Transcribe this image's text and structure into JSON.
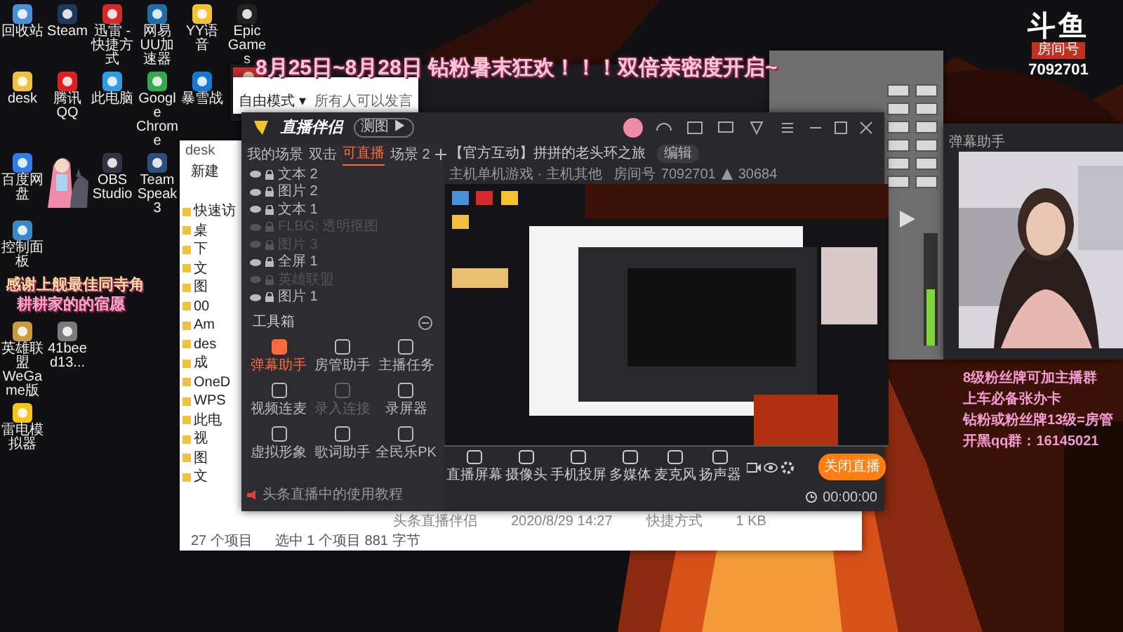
{
  "desktop": {
    "icon_rows": [
      {
        "icons": [
          {
            "kind": "app",
            "label": "回收站",
            "color": "#4a90d9"
          },
          {
            "kind": "app",
            "label": "Steam",
            "color": "#1b3a5c"
          },
          {
            "kind": "app",
            "label": "迅雷 - 快捷方式",
            "color": "#d42a2a"
          },
          {
            "kind": "app",
            "label": "网易UU加速器",
            "color": "#1e6fa8"
          },
          {
            "kind": "app",
            "label": "YY语音",
            "color": "#f2c230"
          },
          {
            "kind": "app",
            "label": "Epic Games",
            "color": "#222222"
          }
        ]
      },
      {
        "icons": [
          {
            "kind": "app",
            "label": "desk",
            "color": "#f0c040"
          },
          {
            "kind": "app",
            "label": "腾讯QQ",
            "color": "#e02020"
          },
          {
            "kind": "app",
            "label": "此电脑",
            "color": "#2f9be0"
          },
          {
            "kind": "app",
            "label": "Google Chrome",
            "color": "#34a853"
          },
          {
            "kind": "app",
            "label": "暴雪战",
            "color": "#1479d4"
          }
        ]
      },
      {
        "icons": [
          {
            "kind": "app",
            "label": "百度网盘",
            "color": "#2f7be8"
          },
          {
            "kind": "picture"
          },
          {
            "kind": "app",
            "label": "OBS Studio",
            "color": "#333344"
          },
          {
            "kind": "app",
            "label": "TeamSpeak 3",
            "color": "#2b4f80"
          }
        ]
      },
      {
        "icons": [
          {
            "kind": "app",
            "label": "控制面板",
            "color": "#3a88c8"
          }
        ]
      },
      {
        "icons": [
          {
            "kind": "app",
            "label": "英雄联盟WeGame版",
            "color": "#c89b3c"
          },
          {
            "kind": "app",
            "label": "41beed13...",
            "color": "#7a7a7a"
          }
        ]
      },
      {
        "icons": [
          {
            "kind": "app",
            "label": "雷电模拟器",
            "color": "#f5c518"
          }
        ]
      }
    ]
  },
  "overlays": {
    "banner": "8月25日~8月28日 钻粉暑末狂欢！！！双倍亲密度开启~",
    "left_caption": [
      "感谢上舰最佳同寺角",
      "耕耕家的的宿愿"
    ],
    "room_badge": {
      "brand": "斗鱼",
      "caption": "房间号",
      "number": "7092701"
    },
    "fan_notice": [
      "8级粉丝牌可加主播群",
      "上车必备张办卡",
      "钻粉或粉丝牌13级=房管",
      "开黑qq群：16145021"
    ]
  },
  "chat_window": {
    "mode": "自由模式 ▾",
    "hint": "所有人可以发言"
  },
  "explorer": {
    "title": "desk",
    "new_button": "新建",
    "nav": [
      "快速访",
      "桌",
      "下",
      "文",
      "图",
      "00",
      "Am",
      "des",
      "成",
      "OneD",
      "WPS",
      "此电",
      "视",
      "图",
      "文"
    ],
    "file": {
      "name": "头条直播伴侣",
      "date": "2020/8/29 14:27",
      "type": "快捷方式",
      "size": "1 KB"
    },
    "status": [
      "27 个项目",
      "选中 1 个项目  881 字节"
    ]
  },
  "streamer": {
    "app_name": "直播伴侣",
    "badge": "测图 ▶",
    "scene_tabs": [
      {
        "label": "我的场景",
        "selected": false
      },
      {
        "label": "双击",
        "selected": false
      },
      {
        "label": "可直播",
        "selected": true
      },
      {
        "label": "场景 2",
        "selected": false
      }
    ],
    "sources": [
      {
        "label": "文本 2",
        "disabled": false
      },
      {
        "label": "图片 2",
        "disabled": false
      },
      {
        "label": "文本 1",
        "disabled": false
      },
      {
        "label": "FLBG: 透明抠图",
        "disabled": true
      },
      {
        "label": "图片 3",
        "disabled": true
      },
      {
        "label": "全屏 1",
        "disabled": false
      },
      {
        "label": "英雄联盟",
        "disabled": true
      },
      {
        "label": "图片 1",
        "disabled": false
      }
    ],
    "toolbox_title": "工具箱",
    "tools": [
      {
        "label": "弹幕助手",
        "selected": true,
        "disabled": false
      },
      {
        "label": "房管助手",
        "selected": false,
        "disabled": false
      },
      {
        "label": "主播任务",
        "selected": false,
        "disabled": false
      },
      {
        "label": "视频连麦",
        "selected": false,
        "disabled": false
      },
      {
        "label": "录入连接",
        "selected": false,
        "disabled": true
      },
      {
        "label": "录屏器",
        "selected": false,
        "disabled": false
      },
      {
        "label": "虚拟形象",
        "selected": false,
        "disabled": false
      },
      {
        "label": "歌词助手",
        "selected": false,
        "disabled": false
      },
      {
        "label": "全民乐PK",
        "selected": false,
        "disabled": false
      }
    ],
    "tutorial": "头条直播中的使用教程",
    "room_title": "【官方互动】拼拼的老头环之旅",
    "edit": "编辑",
    "category": "主机单机游戏 · 主机其他",
    "room_label": "房间号",
    "room_number": "7092701",
    "heat": "30684",
    "controls": [
      "直播屏幕",
      "摄像头",
      "手机投屏",
      "多媒体",
      "麦克风",
      "扬声器"
    ],
    "stop_button": "关闭直播",
    "timer": "00:00:00"
  },
  "webcam_window": {
    "title": "弹幕助手"
  }
}
